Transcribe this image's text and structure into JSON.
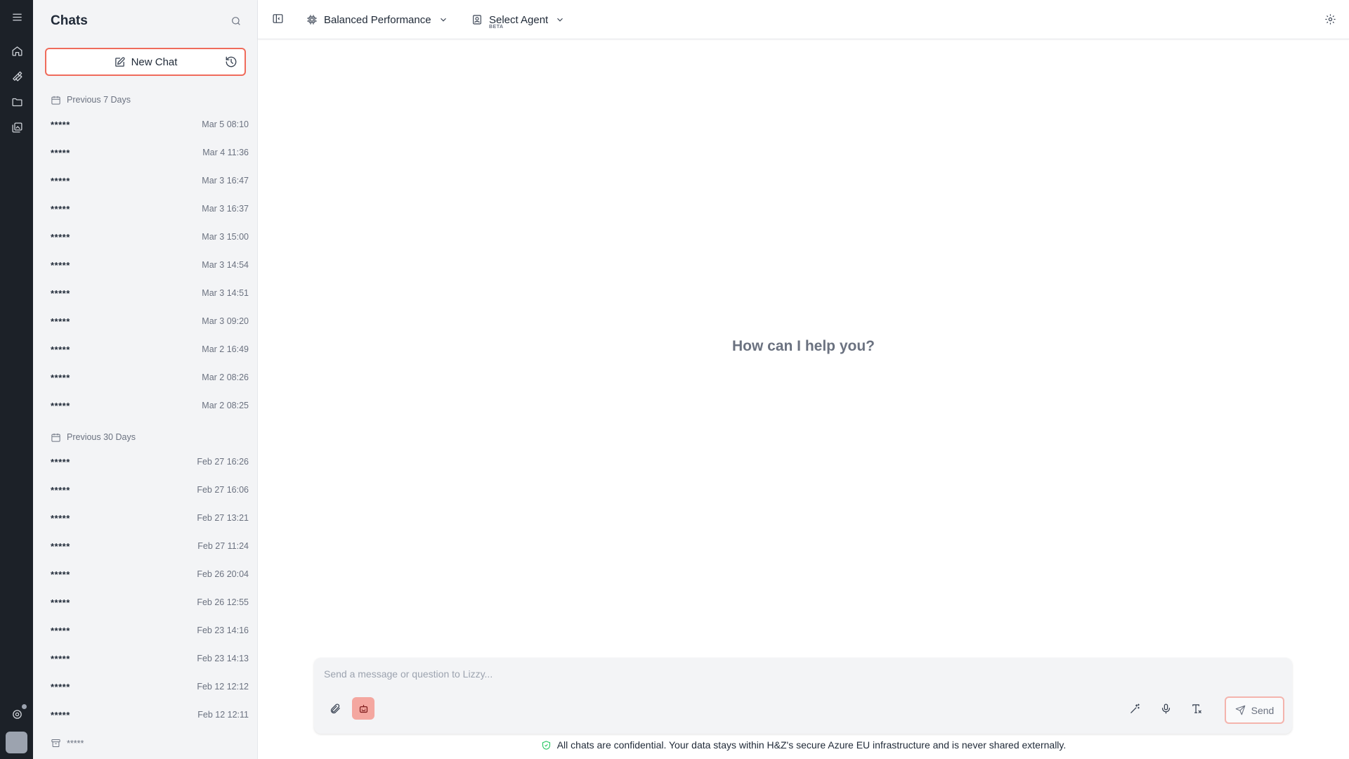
{
  "rail": {
    "icons": [
      "menu-icon",
      "home-icon",
      "tools-icon",
      "folder-icon",
      "gallery-icon",
      "support-icon"
    ]
  },
  "sidebar": {
    "title": "Chats",
    "new_chat_label": "New Chat",
    "groups": [
      {
        "label": "Previous 7 Days",
        "items": [
          {
            "title": "*****",
            "time": "Mar 5 08:10"
          },
          {
            "title": "*****",
            "time": "Mar 4 11:36"
          },
          {
            "title": "*****",
            "time": "Mar 3 16:47"
          },
          {
            "title": "*****",
            "time": "Mar 3 16:37"
          },
          {
            "title": "*****",
            "time": "Mar 3 15:00"
          },
          {
            "title": "*****",
            "time": "Mar 3 14:54"
          },
          {
            "title": "*****",
            "time": "Mar 3 14:51"
          },
          {
            "title": "*****",
            "time": "Mar 3 09:20"
          },
          {
            "title": "*****",
            "time": "Mar 2 16:49"
          },
          {
            "title": "*****",
            "time": "Mar 2 08:26"
          },
          {
            "title": "*****",
            "time": "Mar 2 08:25"
          }
        ]
      },
      {
        "label": "Previous 30 Days",
        "items": [
          {
            "title": "*****",
            "time": "Feb 27 16:26"
          },
          {
            "title": "*****",
            "time": "Feb 27 16:06"
          },
          {
            "title": "*****",
            "time": "Feb 27 13:21"
          },
          {
            "title": "*****",
            "time": "Feb 27 11:24"
          },
          {
            "title": "*****",
            "time": "Feb 26 20:04"
          },
          {
            "title": "*****",
            "time": "Feb 26 12:55"
          },
          {
            "title": "*****",
            "time": "Feb 23 14:16"
          },
          {
            "title": "*****",
            "time": "Feb 23 14:13"
          },
          {
            "title": "*****",
            "time": "Feb 12 12:12"
          },
          {
            "title": "*****",
            "time": "Feb 12 12:11"
          }
        ]
      }
    ],
    "bottom_group_label": "*****"
  },
  "topbar": {
    "model_label": "Balanced Performance",
    "agent_label": "Select Agent",
    "agent_badge": "BETA"
  },
  "main": {
    "greeting": "How can I help you?"
  },
  "composer": {
    "placeholder": "Send a message or question to Lizzy...",
    "value": "",
    "send_label": "Send"
  },
  "footer": {
    "notice": "All chats are confidential. Your data stays within H&Z's secure Azure EU infrastructure and is never shared externally."
  },
  "colors": {
    "rail_bg": "#1c2128",
    "sidebar_bg": "#f3f4f6",
    "accent": "#ef6b5b",
    "secure_green": "#22c55e"
  }
}
